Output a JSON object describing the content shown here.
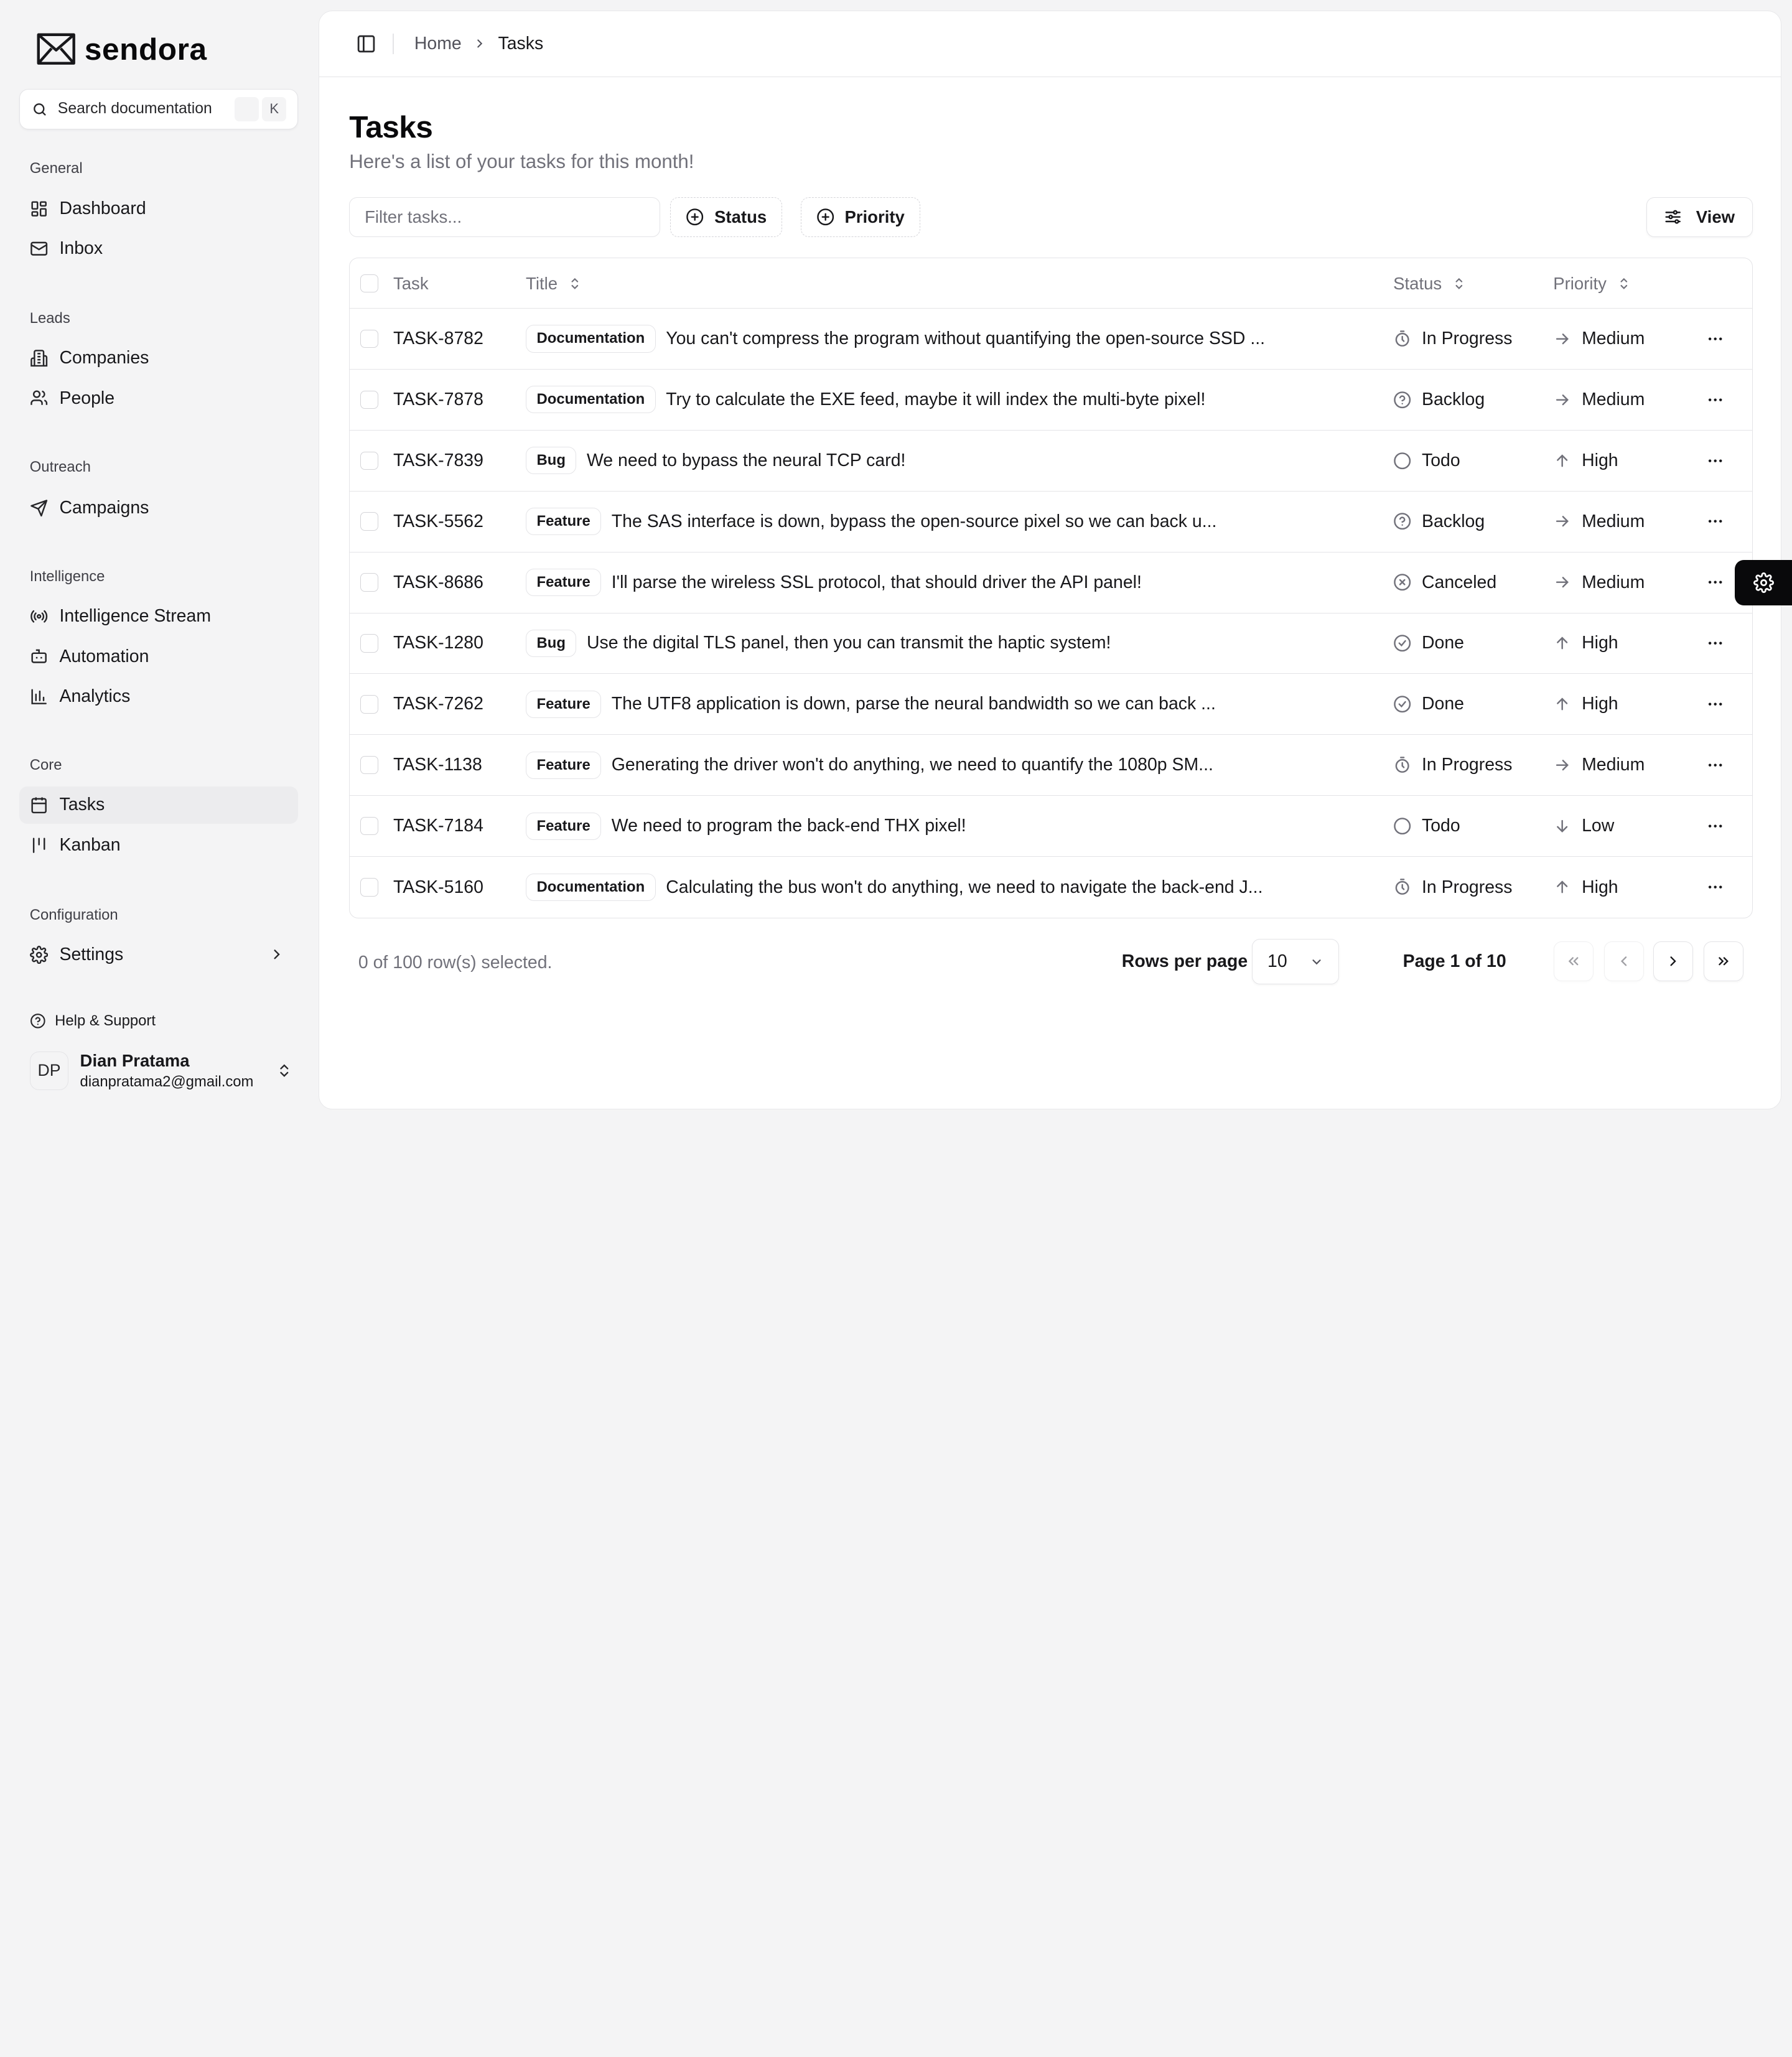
{
  "brand": {
    "name": "sendora"
  },
  "search": {
    "placeholder": "Search documentation",
    "shortcut_mod": "",
    "shortcut_key": "K"
  },
  "sidebar": {
    "groups": [
      {
        "label": "General",
        "items": [
          {
            "label": "Dashboard",
            "icon": "dashboard-icon"
          },
          {
            "label": "Inbox",
            "icon": "mail-icon"
          }
        ]
      },
      {
        "label": "Leads",
        "items": [
          {
            "label": "Companies",
            "icon": "building-icon"
          },
          {
            "label": "People",
            "icon": "users-icon"
          }
        ]
      },
      {
        "label": "Outreach",
        "items": [
          {
            "label": "Campaigns",
            "icon": "send-icon"
          }
        ]
      },
      {
        "label": "Intelligence",
        "items": [
          {
            "label": "Intelligence Stream",
            "icon": "radio-icon"
          },
          {
            "label": "Automation",
            "icon": "bot-icon"
          },
          {
            "label": "Analytics",
            "icon": "bar-chart-icon"
          }
        ]
      },
      {
        "label": "Core",
        "items": [
          {
            "label": "Tasks",
            "icon": "calendar-icon",
            "active": true
          },
          {
            "label": "Kanban",
            "icon": "kanban-icon"
          }
        ]
      },
      {
        "label": "Configuration",
        "items": [
          {
            "label": "Settings",
            "icon": "gear-icon"
          }
        ]
      }
    ],
    "help": "Help & Support",
    "user": {
      "initials": "DP",
      "name": "Dian Pratama",
      "email": "dianpratama2@gmail.com"
    }
  },
  "breadcrumb": {
    "home": "Home",
    "current": "Tasks"
  },
  "page": {
    "title": "Tasks",
    "subtitle": "Here's a list of your tasks for this month!"
  },
  "toolbar": {
    "filter_placeholder": "Filter tasks...",
    "status_label": "Status",
    "priority_label": "Priority",
    "view_label": "View"
  },
  "table": {
    "headers": {
      "task": "Task",
      "title": "Title",
      "status": "Status",
      "priority": "Priority"
    },
    "rows": [
      {
        "id": "TASK-8782",
        "label": "Documentation",
        "title": "You can't compress the program without quantifying the open-source SSD ...",
        "status": "In Progress",
        "status_icon": "timer-icon",
        "priority": "Medium",
        "priority_icon": "arrow-right-icon"
      },
      {
        "id": "TASK-7878",
        "label": "Documentation",
        "title": "Try to calculate the EXE feed, maybe it will index the multi-byte pixel!",
        "status": "Backlog",
        "status_icon": "help-circle-icon",
        "priority": "Medium",
        "priority_icon": "arrow-right-icon"
      },
      {
        "id": "TASK-7839",
        "label": "Bug",
        "title": "We need to bypass the neural TCP card!",
        "status": "Todo",
        "status_icon": "circle-icon",
        "priority": "High",
        "priority_icon": "arrow-up-icon"
      },
      {
        "id": "TASK-5562",
        "label": "Feature",
        "title": "The SAS interface is down, bypass the open-source pixel so we can back u...",
        "status": "Backlog",
        "status_icon": "help-circle-icon",
        "priority": "Medium",
        "priority_icon": "arrow-right-icon"
      },
      {
        "id": "TASK-8686",
        "label": "Feature",
        "title": "I'll parse the wireless SSL protocol, that should driver the API panel!",
        "status": "Canceled",
        "status_icon": "x-circle-icon",
        "priority": "Medium",
        "priority_icon": "arrow-right-icon"
      },
      {
        "id": "TASK-1280",
        "label": "Bug",
        "title": "Use the digital TLS panel, then you can transmit the haptic system!",
        "status": "Done",
        "status_icon": "check-circle-icon",
        "priority": "High",
        "priority_icon": "arrow-up-icon"
      },
      {
        "id": "TASK-7262",
        "label": "Feature",
        "title": "The UTF8 application is down, parse the neural bandwidth so we can back ...",
        "status": "Done",
        "status_icon": "check-circle-icon",
        "priority": "High",
        "priority_icon": "arrow-up-icon"
      },
      {
        "id": "TASK-1138",
        "label": "Feature",
        "title": "Generating the driver won't do anything, we need to quantify the 1080p SM...",
        "status": "In Progress",
        "status_icon": "timer-icon",
        "priority": "Medium",
        "priority_icon": "arrow-right-icon"
      },
      {
        "id": "TASK-7184",
        "label": "Feature",
        "title": "We need to program the back-end THX pixel!",
        "status": "Todo",
        "status_icon": "circle-icon",
        "priority": "Low",
        "priority_icon": "arrow-down-icon"
      },
      {
        "id": "TASK-5160",
        "label": "Documentation",
        "title": "Calculating the bus won't do anything, we need to navigate the back-end J...",
        "status": "In Progress",
        "status_icon": "timer-icon",
        "priority": "High",
        "priority_icon": "arrow-up-icon"
      }
    ]
  },
  "footer": {
    "selection": "0 of 100 row(s) selected.",
    "rows_per_page_label": "Rows per page",
    "rows_per_page_value": "10",
    "page_text": "Page 1 of 10"
  }
}
